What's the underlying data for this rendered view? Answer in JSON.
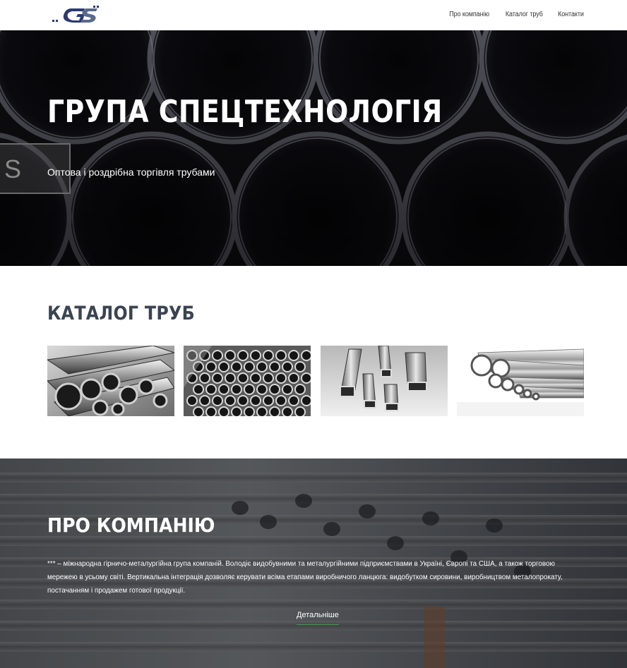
{
  "header": {
    "logo_text": "GS",
    "nav": [
      {
        "label": "Про компанію"
      },
      {
        "label": "Каталог труб"
      },
      {
        "label": "Контакти"
      }
    ]
  },
  "hero": {
    "title": "ГРУПА СПЕЦТЕХНОЛОГІЯ",
    "subtitle": "Оптова і роздрібна торгівля трубами",
    "badge_letter": "S"
  },
  "catalog": {
    "title": "КАТАЛОГ ТРУБ",
    "tiles": [
      {
        "icon": "steel-pipes-bundle-image"
      },
      {
        "icon": "pipe-stack-image"
      },
      {
        "icon": "square-profile-pipes-image"
      },
      {
        "icon": "polished-pipes-image"
      }
    ]
  },
  "about": {
    "title": "ПРО КОМПАНІЮ",
    "text": "*** – міжнародна гірничо-металургійна група компаній. Володіє видобувними та металургійними підприємствами в Україні, Європі та США, а також торговою мережею в усьому світі. Вертикальна інтеграція дозволяє керувати всіма етапами виробничого ланцюга: видобутком сировини, виробництвом металопрокату, постачанням і продажем готової продукції.",
    "more_label": "Детальніше"
  },
  "colors": {
    "heading": "#3b4452",
    "accent_underline": "#3f9a4a",
    "logo_blue": "#2b3a72"
  }
}
